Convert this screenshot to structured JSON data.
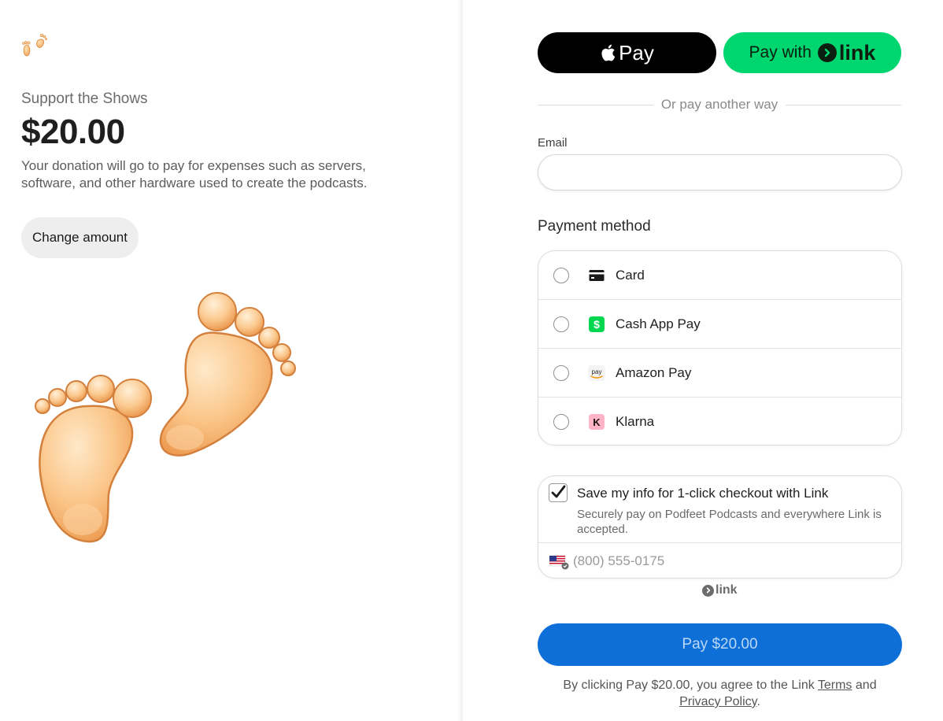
{
  "left": {
    "product_name": "Support the Shows",
    "price": "$20.00",
    "description": "Your donation will go to pay for expenses such as servers, software, and other hardware used to create the podcasts.",
    "change_amount_label": "Change amount",
    "logo_icon": "footprints-icon",
    "product_image_icon": "footprints-icon"
  },
  "express": {
    "apple_pay_label": "Pay",
    "link_pay_prefix": "Pay with",
    "link_brand": "link"
  },
  "divider_text": "Or pay another way",
  "email": {
    "label": "Email",
    "value": "",
    "placeholder": ""
  },
  "payment_method": {
    "title": "Payment method",
    "options": [
      {
        "label": "Card",
        "icon": "credit-card-icon"
      },
      {
        "label": "Cash App Pay",
        "icon": "cash-app-icon",
        "icon_text": "$"
      },
      {
        "label": "Amazon Pay",
        "icon": "amazon-pay-icon",
        "icon_text": "pay"
      },
      {
        "label": "Klarna",
        "icon": "klarna-icon",
        "icon_text": "K"
      }
    ]
  },
  "save_info": {
    "checked": true,
    "title": "Save my info for 1-click checkout with Link",
    "subtitle": "Securely pay on Podfeet Podcasts and everywhere Link is accepted.",
    "phone_placeholder": "(800) 555-0175",
    "country_icon": "us-flag-icon"
  },
  "link_footer_brand": "link",
  "pay_button_label": "Pay $20.00",
  "legal": {
    "prefix": "By clicking Pay $20.00, you agree to the Link",
    "terms": "Terms",
    "and": "and",
    "privacy": "Privacy Policy",
    "suffix": "."
  },
  "colors": {
    "link_green": "#00d66f",
    "pay_blue": "#0e6fd8",
    "cash_app_green": "#00d64f",
    "klarna_pink": "#ffb3c7"
  }
}
